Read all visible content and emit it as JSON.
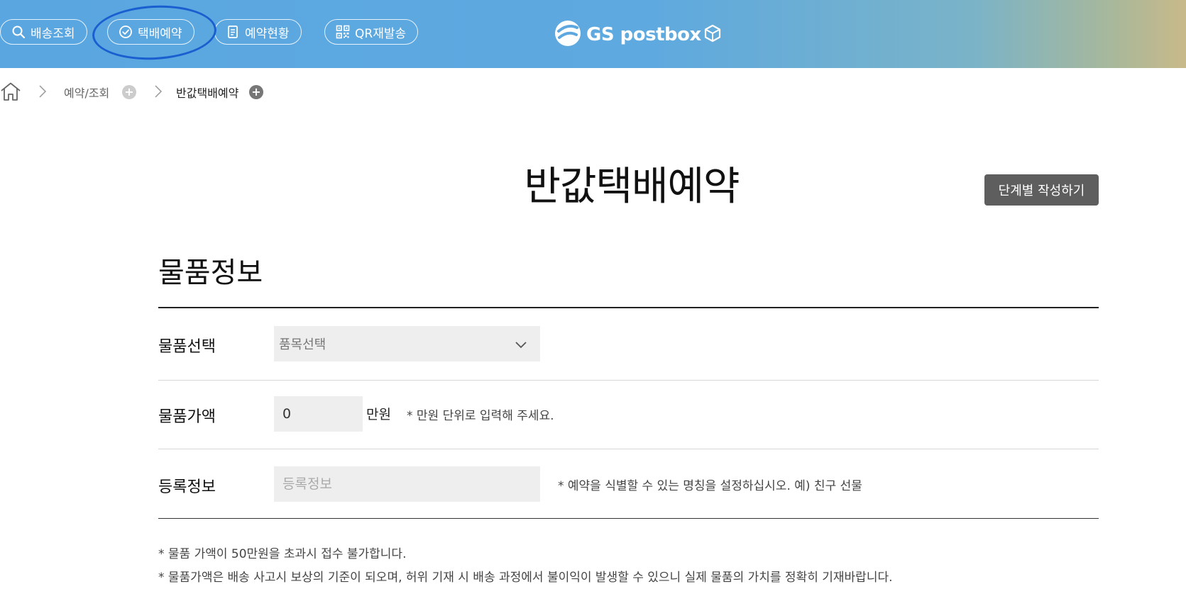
{
  "header": {
    "nav": [
      {
        "label": "배송조회",
        "icon": "search-icon"
      },
      {
        "label": "택배예약",
        "icon": "check-clock-icon"
      },
      {
        "label": "예약현황",
        "icon": "document-icon"
      },
      {
        "label": "QR재발송",
        "icon": "qr-code-icon"
      }
    ],
    "logo_text": "GS postbox",
    "highlighted_item": "택배예약",
    "highlight_color": "#1a5fcf"
  },
  "breadcrumb": {
    "home_icon": "home-icon",
    "items": [
      {
        "label": "예약/조회",
        "plus_color": "#cccccc"
      },
      {
        "label": "반값택배예약",
        "plus_color": "#777777"
      }
    ]
  },
  "page": {
    "title": "반값택배예약",
    "step_button": "단계별 작성하기"
  },
  "section": {
    "title": "물품정보",
    "rows": {
      "item_select": {
        "label": "물품선택",
        "selected": "품목선택"
      },
      "item_value": {
        "label": "물품가액",
        "value": "0",
        "unit": "만원",
        "hint": "* 만원 단위로 입력해 주세요."
      },
      "registration": {
        "label": "등록정보",
        "placeholder": "등록정보",
        "hint": "* 예약을 식별할 수 있는 명칭을 설정하십시오. 예) 친구 선물"
      }
    },
    "notes": [
      "* 물품 가액이 50만원을 초과시 접수 불가합니다.",
      "* 물품가액은 배송 사고시 보상의 기준이 되오며, 허위 기재 시 배송 과정에서 불이익이 발생할 수 있으니 실제 물품의 가치를 정확히 기재바랍니다."
    ]
  }
}
